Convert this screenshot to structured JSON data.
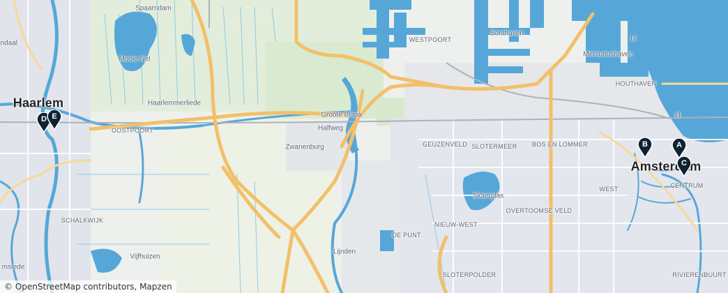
{
  "map": {
    "attribution": "© OpenStreetMap contributors, Mapzen",
    "labels": {
      "spaarndam": "Spaarndam",
      "westpoort": "WESTPOORT",
      "sonthaven": "Sonthaven",
      "mercuriushaven": "Mercuriushaven",
      "ij_top": "IJ",
      "ij_right": "IJ",
      "endaal": "endaal",
      "haarlem": "Haarlem",
      "mooie_nel": "Mooie Nel",
      "haarlemmerliede": "Haarlemmerliede",
      "houthaven": "HOUTHAVEN",
      "groote_braak": "Groote Braak",
      "oostpoort": "OOSTPOORT",
      "halfweg": "Halfweg",
      "zwanenburg": "Zwanenburg",
      "geuzenveld": "GEUZENVELD",
      "slotermeer": "SLOTERMEER",
      "bos_en_lommer": "BOS EN LOMMER",
      "amsterdam": "Amsterdam",
      "west": "WEST",
      "centrum": "CENTRUM",
      "sloterplas": "Sloterplas",
      "overtoomse_veld": "OVERTOOMSE VELD",
      "schalkwijk": "SCHALKWIJK",
      "nieuw_west": "NIEUW-WEST",
      "de_punt": "DE PUNT",
      "vijfhuizen": "Vijfhuizen",
      "lijnden": "Lijnden",
      "amstede": "mstede",
      "slotervaart": "SLOTERPOLDER",
      "rivierenbuurt": "RIVIERENBUURT"
    },
    "markers": [
      {
        "letter": "D",
        "color": "#0d2233"
      },
      {
        "letter": "E",
        "color": "#0d2233"
      },
      {
        "letter": "B",
        "color": "#0d2233"
      },
      {
        "letter": "A",
        "color": "#0d2233"
      },
      {
        "letter": "C",
        "color": "#0d2233"
      }
    ],
    "colors": {
      "water": "#56a7d8",
      "land": "#eef0ed",
      "green": "#dfecd6",
      "urban": "#e0e3ea",
      "motorway": "#f3c46e",
      "marker": "#0d2233"
    }
  }
}
